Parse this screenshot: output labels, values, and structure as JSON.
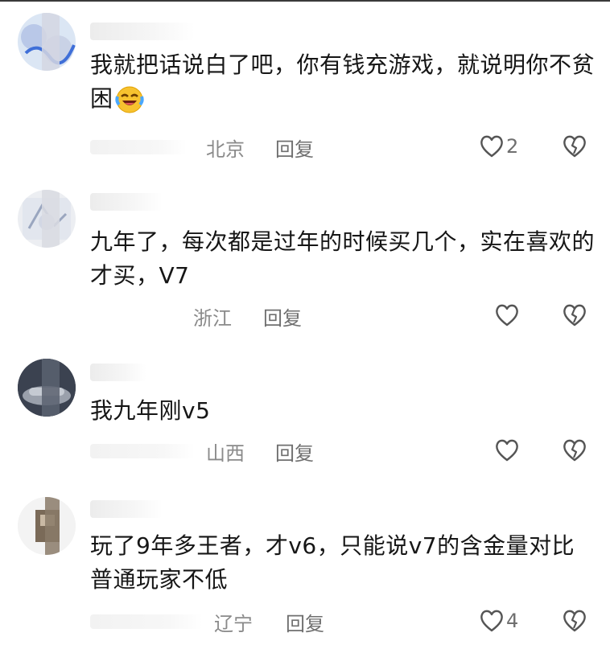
{
  "comments": [
    {
      "text": "我就把话说白了吧，你有钱充游戏，就说明你不贫困",
      "emoji": "laughing-crying-face-icon",
      "location": "北京",
      "reply_label": "回复",
      "likes": "2"
    },
    {
      "text": "九年了，每次都是过年的时候买几个，实在喜欢的才买，V7",
      "location": "浙江",
      "reply_label": "回复",
      "likes": ""
    },
    {
      "text": "我九年刚v5",
      "location": "山西",
      "reply_label": "回复",
      "likes": ""
    },
    {
      "text": "玩了9年多王者，才v6，只能说v7的含金量对比普通玩家不低",
      "location": "辽宁",
      "reply_label": "回复",
      "likes": "4"
    }
  ],
  "colors": {
    "text": "#161616",
    "meta": "#8a8a8a",
    "icon": "#555555"
  }
}
